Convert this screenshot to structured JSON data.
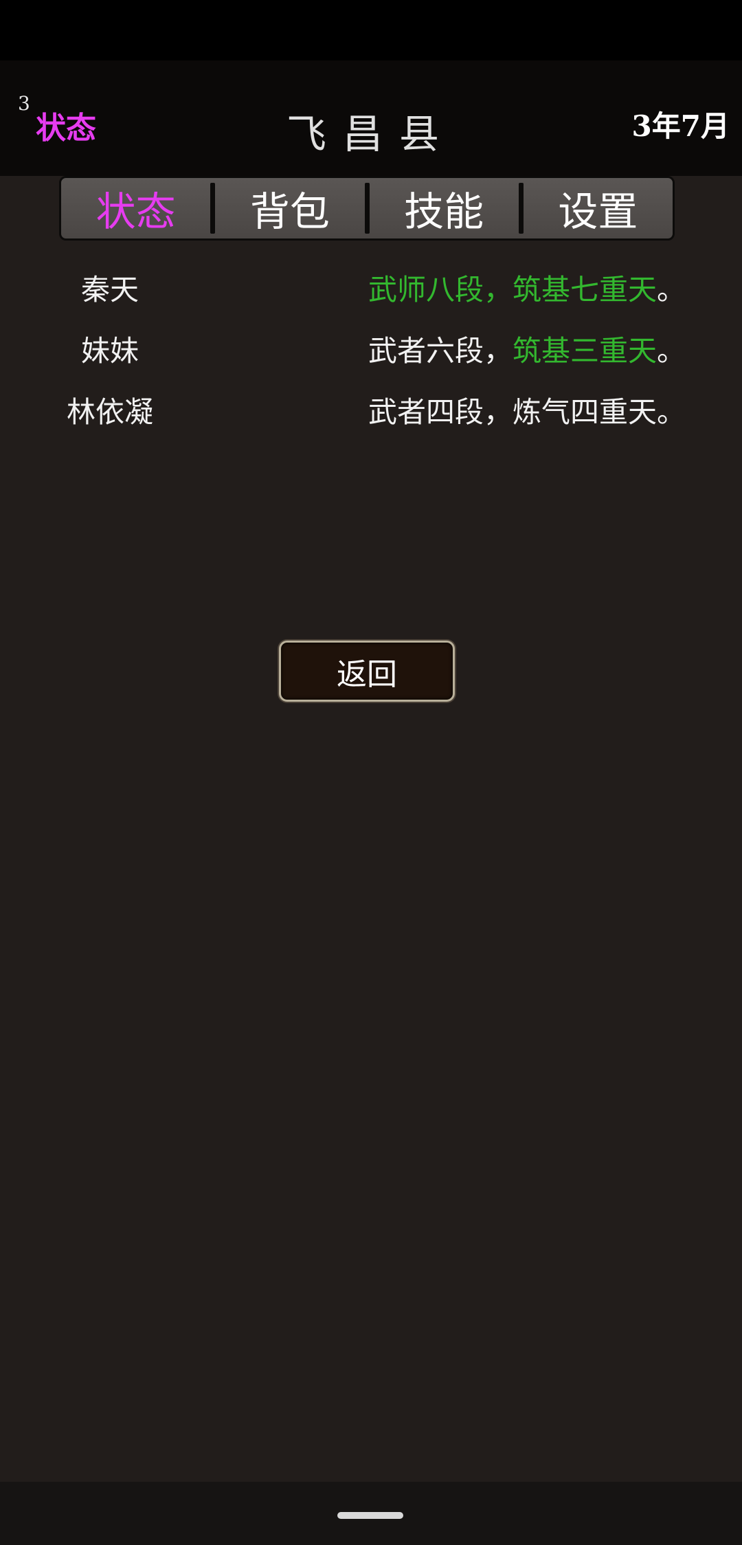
{
  "header": {
    "count": "3",
    "status_label": "状态",
    "title": "飞昌县",
    "date": "3年7月"
  },
  "tabs": [
    {
      "label": "状态",
      "active": true
    },
    {
      "label": "背包",
      "active": false
    },
    {
      "label": "技能",
      "active": false
    },
    {
      "label": "设置",
      "active": false
    }
  ],
  "characters": [
    {
      "name": "秦天",
      "rank1": "武师八段",
      "sep": "，",
      "rank2": "筑基七重天",
      "end": "。",
      "rank1_green": true,
      "rank2_green": true
    },
    {
      "name": "妹妹",
      "rank1": "武者六段",
      "sep": "，",
      "rank2": "筑基三重天",
      "end": "。",
      "rank1_green": false,
      "rank2_green": true
    },
    {
      "name": "林依凝",
      "rank1": "武者四段",
      "sep": "，",
      "rank2": "炼气四重天",
      "end": "。",
      "rank1_green": false,
      "rank2_green": false
    }
  ],
  "back_button": "返回",
  "colors": {
    "accent_magenta": "#e63cf0",
    "rank_green": "#33b82f",
    "background": "#221d1b"
  }
}
